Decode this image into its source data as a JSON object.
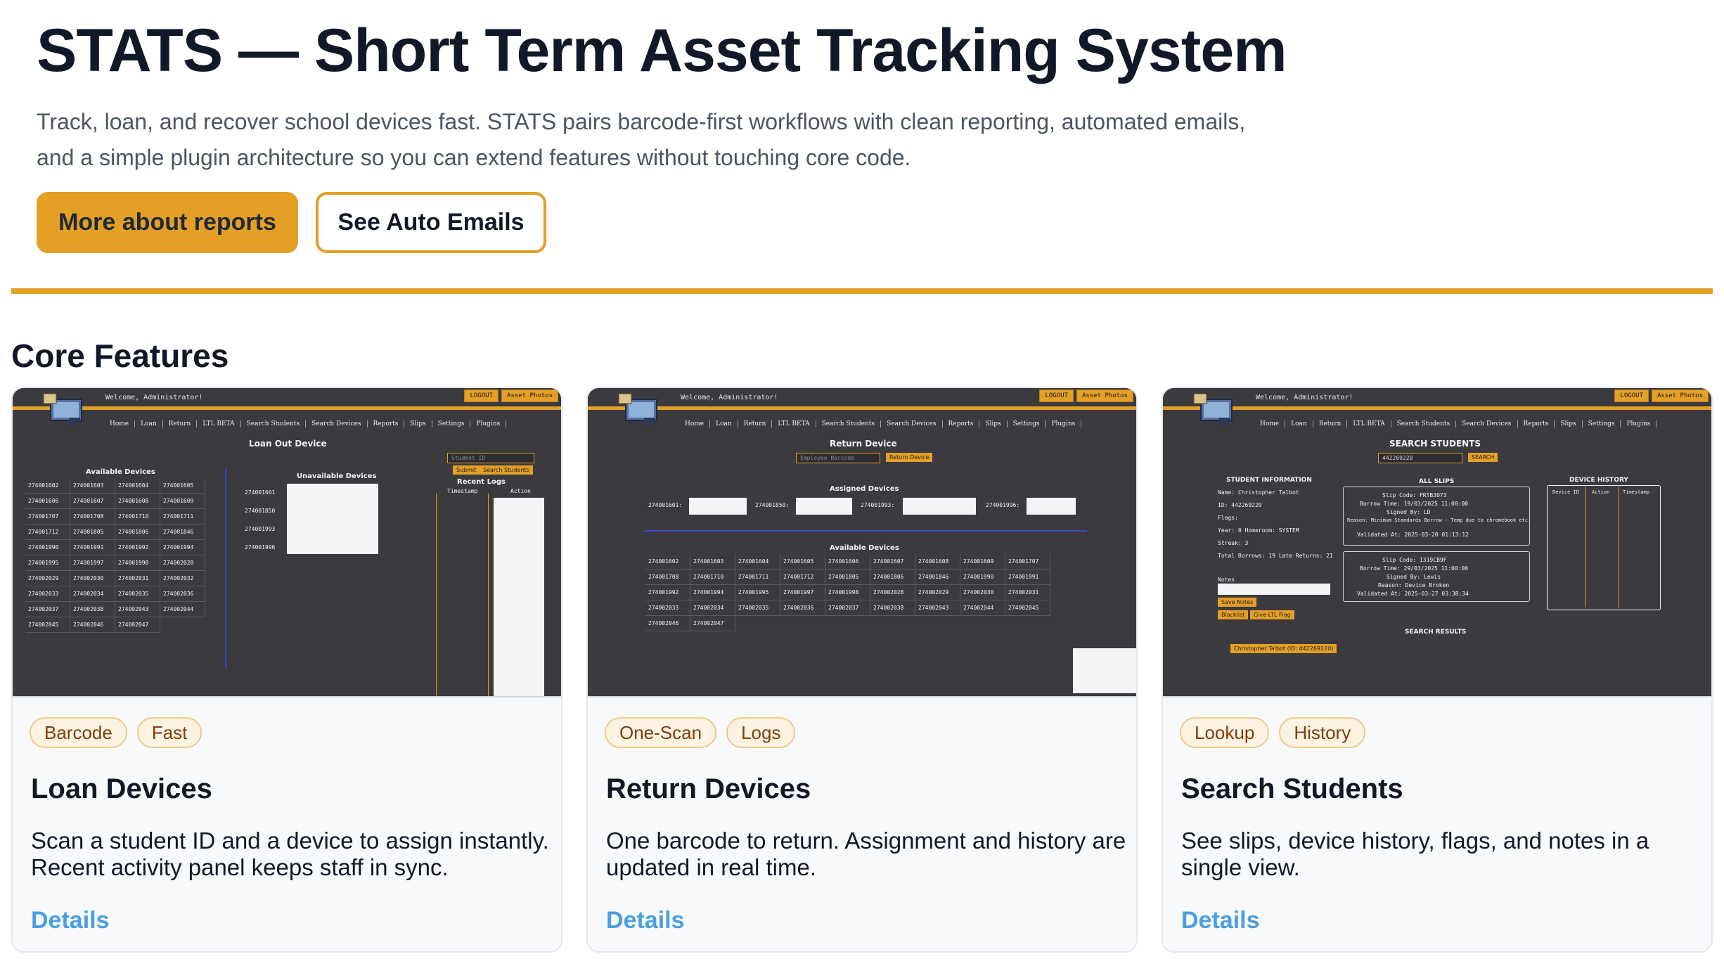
{
  "hero": {
    "title": "STATS — Short Term Asset Tracking System",
    "subtitle": "Track, loan, and recover school devices fast. STATS pairs barcode-first workflows with clean reporting, automated emails, and a simple plugin architecture so you can extend features without touching core code.",
    "primary_button": "More about reports",
    "secondary_button": "See Auto Emails"
  },
  "section": {
    "title": "Core Features"
  },
  "cards": [
    {
      "tags": [
        "Barcode",
        "Fast"
      ],
      "title": "Loan Devices",
      "description": "Scan a student ID and a device to assign instantly. Recent activity panel keeps staff in sync.",
      "link": "Details"
    },
    {
      "tags": [
        "One-Scan",
        "Logs"
      ],
      "title": "Return Devices",
      "description": "One barcode to return. Assignment and history are updated in real time.",
      "link": "Details"
    },
    {
      "tags": [
        "Lookup",
        "History"
      ],
      "title": "Search Students",
      "description": "See slips, device history, flags, and notes in a single view.",
      "link": "Details"
    }
  ],
  "mini_app": {
    "welcome": "Welcome, Administrator!",
    "logout": "LOGOUT",
    "asset_photos": "Asset Photos",
    "nav": [
      "Home",
      "Loan",
      "Return",
      "LTL BETA",
      "Search Students",
      "Search Devices",
      "Reports",
      "Slips",
      "Settings",
      "Plugins"
    ],
    "loan": {
      "title": "Loan Out Device",
      "available": "Available Devices",
      "unavailable": "Unavailable Devices",
      "recent_logs": "Recent Logs",
      "timestamp": "Timestamp",
      "action": "Action",
      "student_placeholder": "Student ID",
      "submit": "Submit",
      "search_students": "Search Students",
      "devices": [
        "274001602",
        "274001603",
        "274001604",
        "274001605",
        "274001606",
        "274001607",
        "274001608",
        "274001609",
        "274001707",
        "274001708",
        "274001710",
        "274001711",
        "274001712",
        "274001805",
        "274001806",
        "274001846",
        "274001990",
        "274001991",
        "274001992",
        "274001994",
        "274001995",
        "274001997",
        "274001998",
        "274002028",
        "274002029",
        "274002030",
        "274002031",
        "274002032",
        "274002033",
        "274002034",
        "274002035",
        "274002036",
        "274002037",
        "274002038",
        "274002043",
        "274002044",
        "274002045",
        "274002046",
        "274002047"
      ],
      "unavailable_devices": [
        "274001601",
        "274001850",
        "274001993",
        "274001996"
      ]
    },
    "return": {
      "title": "Return Device",
      "placeholder": "Employee Barcode",
      "button": "Return Device",
      "assigned": "Assigned Devices",
      "available": "Available Devices",
      "assigned_devices": [
        "274001601:",
        "274001850:",
        "274001993:",
        "274001996:"
      ],
      "devices": [
        "274001602",
        "274001603",
        "274001604",
        "274001605",
        "274001606",
        "274001607",
        "274001608",
        "274001609",
        "274001707",
        "274001708",
        "274001710",
        "274001711",
        "274001712",
        "274001805",
        "274001806",
        "274001846",
        "274001990",
        "274001991",
        "274001992",
        "274001994",
        "274001995",
        "274001997",
        "274001998",
        "274002028",
        "274002029",
        "274002030",
        "274002031",
        "274002033",
        "274002034",
        "274002035",
        "274002036",
        "274002037",
        "274002038",
        "274002043",
        "274002044",
        "274002045",
        "274002046",
        "274002047"
      ]
    },
    "search": {
      "title": "SEARCH STUDENTS",
      "query": "442269220",
      "button": "SEARCH",
      "student_info": "STUDENT INFORMATION",
      "all_slips": "ALL SLIPS",
      "device_history": "DEVICE HISTORY",
      "search_results": "SEARCH RESULTS",
      "name": "Name: Christopher Talbot",
      "id": "ID: 442269220",
      "flags": "Flags:",
      "year": "Year: 0 Homeroom: SYSTEM",
      "streak": "Streak: 3",
      "borrows": "Total Borrows: 19 Late Returns: 21",
      "notes": "Notes",
      "save_notes": "Save Notes",
      "blacklist": "Blacklist",
      "give_flag": "Give LTL Flag",
      "result": "Christopher Talbot (ID: 442269220)",
      "slip1": [
        "Slip Code: FRTB3073",
        "Borrow Time: 19/03/2025 11:00:00",
        "Signed By: LD",
        "Reason: Minimum Standards Borrow - Temp due to chromebook etc.",
        "Validated At: 2025-03-20 01:13:12"
      ],
      "slip2": [
        "Slip Code: 1319CB9F",
        "Borrow Time: 29/03/2025 11:00:00",
        "Signed By: Lewis",
        "Reason: Device Broken",
        "Validated At: 2025-03-27 03:38:34"
      ],
      "history_headers": [
        "Device ID",
        "Action",
        "Timestamp"
      ]
    }
  }
}
